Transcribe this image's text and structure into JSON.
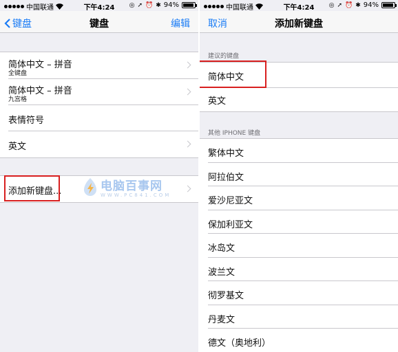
{
  "status_bar": {
    "carrier": "中国联通",
    "time": "下午4:24",
    "battery": "94%",
    "battery_level": 0.94
  },
  "left_screen": {
    "nav": {
      "back_label": "键盘",
      "title": "键盘",
      "edit_label": "编辑"
    },
    "keyboards": [
      {
        "label": "简体中文 – 拼音",
        "sub": "全键盘"
      },
      {
        "label": "简体中文 – 拼音",
        "sub": "九宫格"
      },
      {
        "label": "表情符号",
        "sub": ""
      },
      {
        "label": "英文",
        "sub": ""
      }
    ],
    "add_keyboard_label": "添加新键盘..."
  },
  "right_screen": {
    "nav": {
      "cancel_label": "取消",
      "title": "添加新键盘"
    },
    "suggested_header": "建议的键盘",
    "suggested": [
      "简体中文",
      "英文"
    ],
    "other_header": "其他 IPHONE 键盘",
    "other": [
      "繁体中文",
      "阿拉伯文",
      "爱沙尼亚文",
      "保加利亚文",
      "冰岛文",
      "波兰文",
      "彻罗基文",
      "丹麦文",
      "德文（奥地利）"
    ]
  },
  "watermark": {
    "name": "电脑百事网",
    "url": "WWW.PC841.COM"
  },
  "colors": {
    "accent": "#1a7cf6",
    "highlight": "#d81e1e",
    "background": "#efeff4"
  }
}
